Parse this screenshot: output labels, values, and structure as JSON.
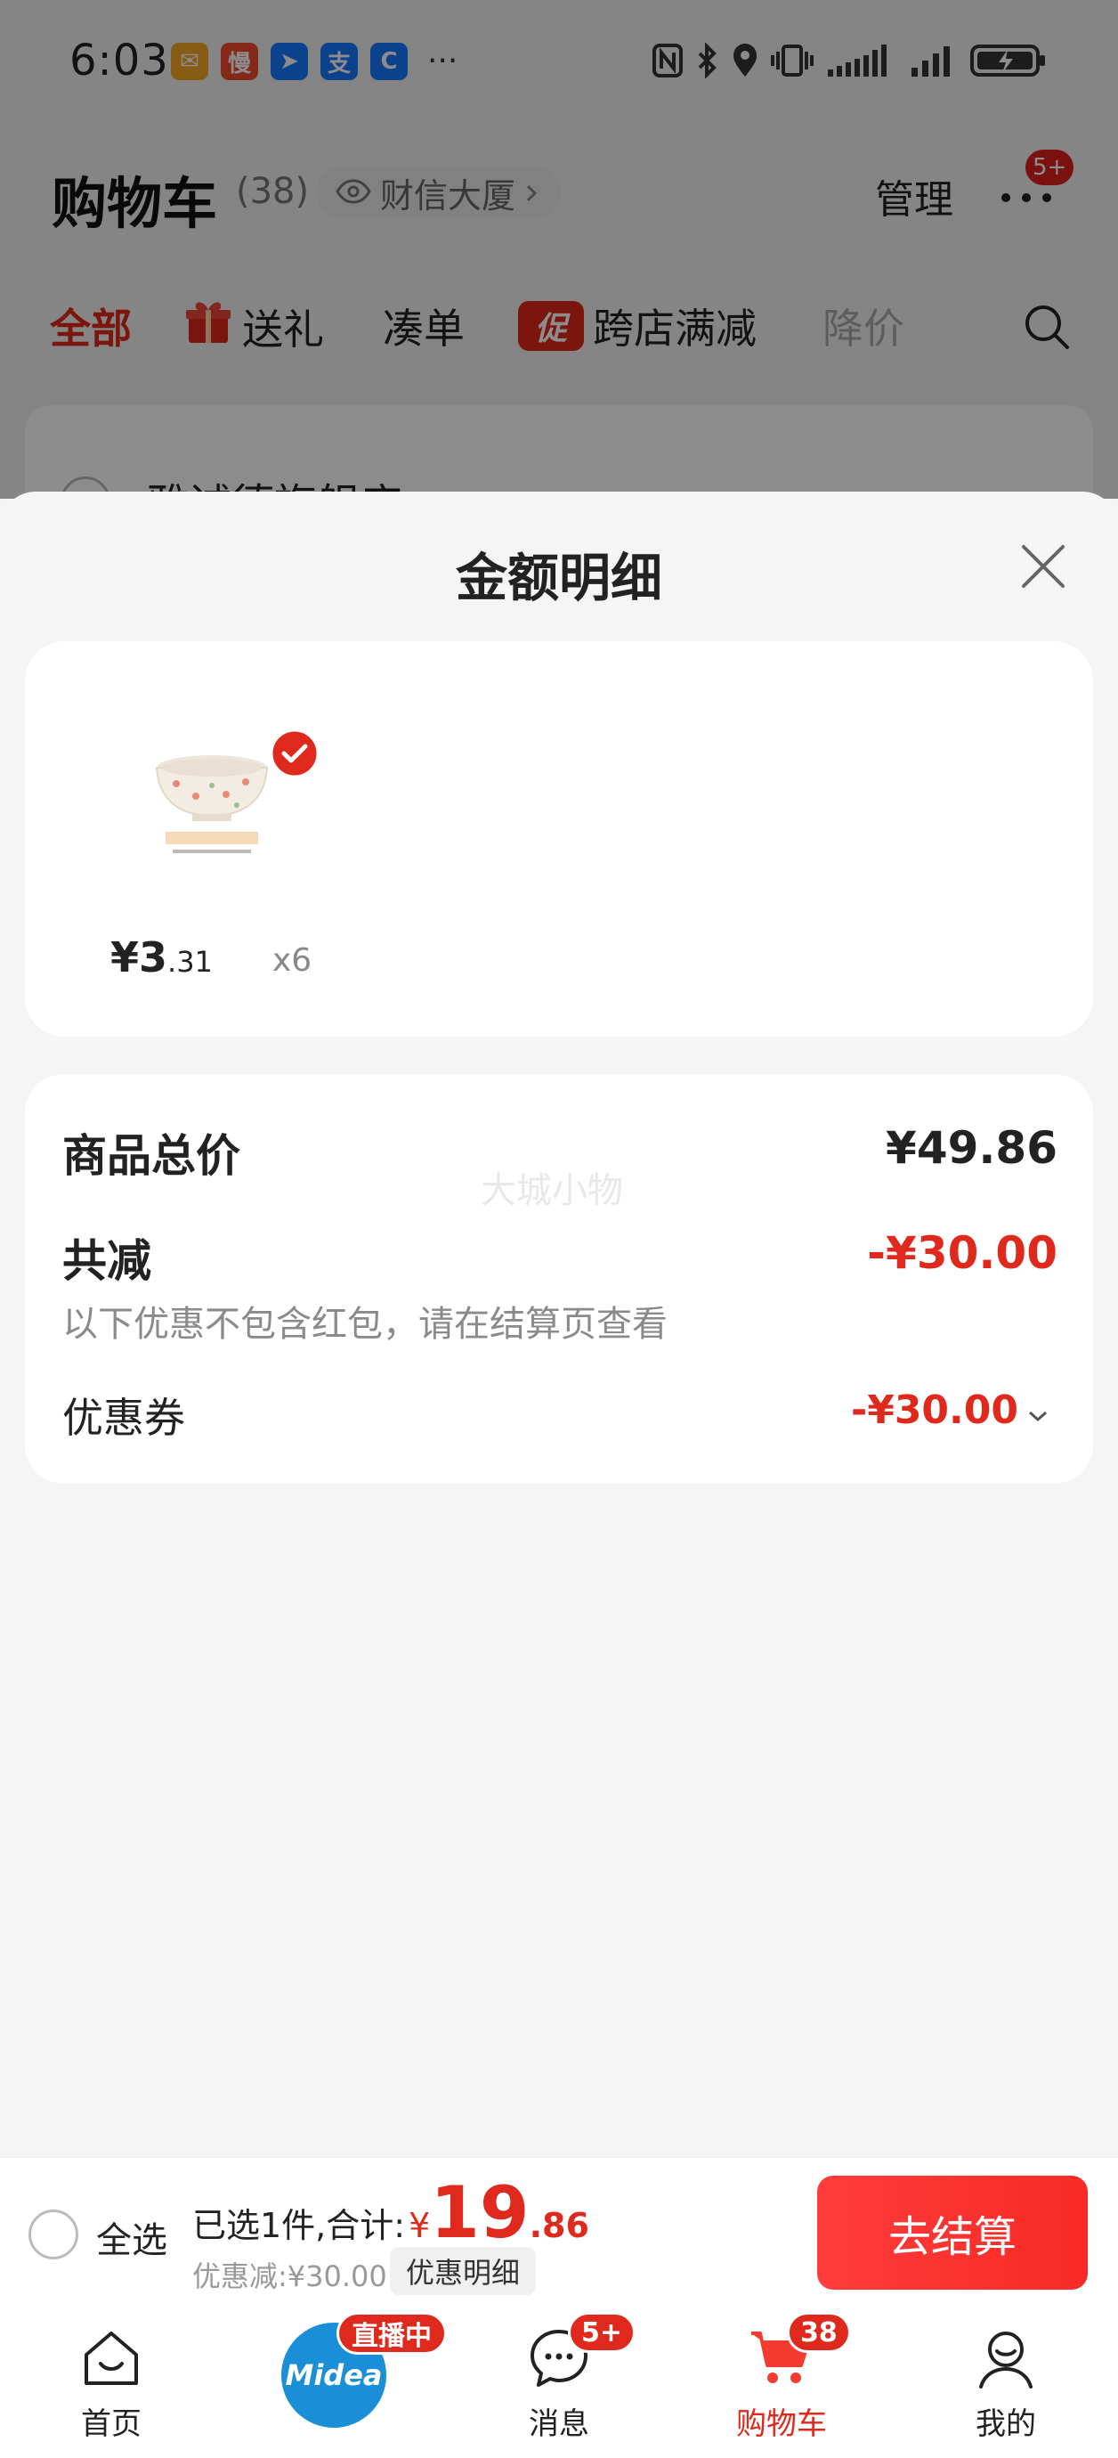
{
  "status_bar": {
    "time": "6:03",
    "app_icons": [
      {
        "name": "mail-app-icon",
        "glyph": "✉",
        "color": "#f5a623"
      },
      {
        "name": "slow-app-icon",
        "glyph": "慢",
        "color": "#f04a2a"
      },
      {
        "name": "feishu-app-icon",
        "glyph": "➤",
        "color": "#1677ff"
      },
      {
        "name": "alipay-app-icon",
        "glyph": "支",
        "color": "#1677ff"
      },
      {
        "name": "bank-app-icon",
        "glyph": "C",
        "color": "#1677ff"
      }
    ],
    "more": "···"
  },
  "header": {
    "title": "购物车",
    "count": "(38)",
    "location": "财信大厦",
    "manage": "管理",
    "more_badge": "5+"
  },
  "filters": [
    {
      "label": "全部",
      "active": true
    },
    {
      "label": "送礼",
      "icon": "gift-icon"
    },
    {
      "label": "凑单"
    },
    {
      "label": "跨店满减",
      "tag": "促"
    },
    {
      "label": "降价",
      "dim": true
    }
  ],
  "store": {
    "name": "雅诚德旗舰店"
  },
  "sheet": {
    "title": "金额明细",
    "product": {
      "price_int": "¥3",
      "price_dec": ".31",
      "qty": "x6"
    },
    "summary": {
      "total_label": "商品总价",
      "total_value": "¥49.86",
      "discount_label": "共减",
      "discount_value": "-¥30.00",
      "note": "以下优惠不包含红包，请在结算页查看",
      "coupon_label": "优惠券",
      "coupon_value": "-¥30.00",
      "watermark": "大城小物"
    }
  },
  "checkout": {
    "select_all": "全选",
    "selected_text": "已选1件,合计:",
    "currency": "¥",
    "total_int": "19",
    "total_dec": ".86",
    "discount_text": "优惠减:¥30.00",
    "detail_button": "优惠明细",
    "checkout_button": "去结算"
  },
  "tabbar": {
    "home": "首页",
    "midea_brand": "Midea",
    "live_badge": "直播中",
    "messages": "消息",
    "messages_badge": "5+",
    "cart": "购物车",
    "cart_badge": "38",
    "profile": "我的"
  },
  "colors": {
    "accent": "#e0291d",
    "midea_blue": "#1a8fd8"
  }
}
